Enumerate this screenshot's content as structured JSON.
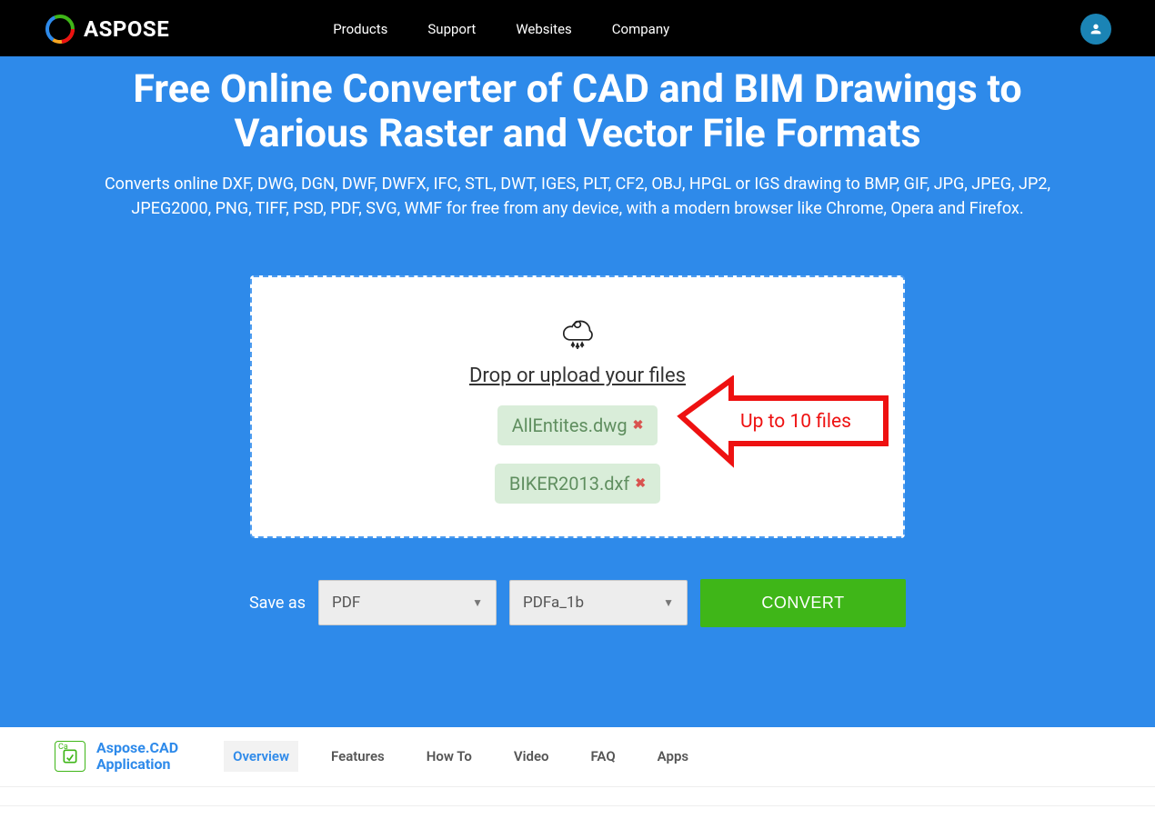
{
  "brand": {
    "name": "ASPOSE"
  },
  "nav": {
    "items": [
      "Products",
      "Support",
      "Websites",
      "Company"
    ]
  },
  "hero": {
    "title": "Free Online Converter of CAD and BIM Drawings to Various Raster and Vector File Formats",
    "subtitle": "Converts online DXF, DWG, DGN, DWF, DWFX, IFC, STL, DWT, IGES, PLT, CF2, OBJ, HPGL or IGS drawing to BMP, GIF, JPG, JPEG, JP2, JPEG2000, PNG, TIFF, PSD, PDF, SVG, WMF for free from any device, with a modern browser like Chrome, Opera and Firefox."
  },
  "drop": {
    "label": "Drop or upload your files",
    "files": [
      "AllEntites.dwg",
      "BIKER2013.dxf"
    ],
    "annotation": "Up to 10 files"
  },
  "save": {
    "label": "Save as",
    "format": "PDF",
    "subformat": "PDFa_1b",
    "button": "CONVERT"
  },
  "footer": {
    "appTitleLine1": "Aspose.CAD",
    "appTitleLine2": "Application",
    "tabs": [
      "Overview",
      "Features",
      "How To",
      "Video",
      "FAQ",
      "Apps"
    ],
    "activeTab": "Overview"
  }
}
